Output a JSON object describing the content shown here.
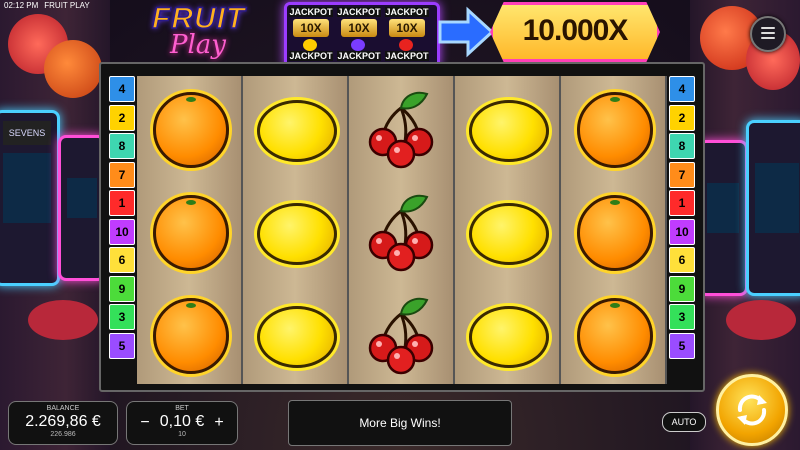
{
  "status_bar": {
    "time": "02:12 PM",
    "app": "FRUIT PLAY"
  },
  "logo": {
    "line1": "FRUIT",
    "line2": "Play"
  },
  "jackpots": [
    {
      "top": "JACKPOT",
      "mult": "10X",
      "bottom": "JACKPOT",
      "symbol_color": "#ffcc00"
    },
    {
      "top": "JACKPOT",
      "mult": "10X",
      "bottom": "JACKPOT",
      "symbol_color": "#7a3cff"
    },
    {
      "top": "JACKPOT",
      "mult": "10X",
      "bottom": "JACKPOT",
      "symbol_color": "#e8231f"
    }
  ],
  "max_win": "10.000X",
  "paylines_left": [
    {
      "n": "4",
      "color": "#2e8fe8"
    },
    {
      "n": "2",
      "color": "#ffd200"
    },
    {
      "n": "8",
      "color": "#3ed6b0"
    },
    {
      "n": "7",
      "color": "#ff8c1a"
    },
    {
      "n": "1",
      "color": "#ff2a2a"
    },
    {
      "n": "10",
      "color": "#c03cff"
    },
    {
      "n": "6",
      "color": "#ffe03a"
    },
    {
      "n": "9",
      "color": "#4cdc3a"
    },
    {
      "n": "3",
      "color": "#34e05a"
    },
    {
      "n": "5",
      "color": "#9a4cff"
    }
  ],
  "paylines_right": [
    {
      "n": "4",
      "color": "#2e8fe8"
    },
    {
      "n": "2",
      "color": "#ffd200"
    },
    {
      "n": "8",
      "color": "#3ed6b0"
    },
    {
      "n": "7",
      "color": "#ff8c1a"
    },
    {
      "n": "1",
      "color": "#ff2a2a"
    },
    {
      "n": "10",
      "color": "#c03cff"
    },
    {
      "n": "6",
      "color": "#ffe03a"
    },
    {
      "n": "9",
      "color": "#4cdc3a"
    },
    {
      "n": "3",
      "color": "#34e05a"
    },
    {
      "n": "5",
      "color": "#9a4cff"
    }
  ],
  "reels": [
    [
      "orange",
      "orange",
      "orange"
    ],
    [
      "lemon",
      "lemon",
      "lemon"
    ],
    [
      "cherry",
      "cherry",
      "cherry"
    ],
    [
      "lemon",
      "lemon",
      "lemon"
    ],
    [
      "orange",
      "orange",
      "orange"
    ]
  ],
  "balance": {
    "label": "BALANCE",
    "value": "2.269,86 €",
    "sub": "226.986"
  },
  "bet": {
    "label": "BET",
    "value": "0,10 €",
    "sub": "10",
    "minus": "−",
    "plus": "+"
  },
  "message": "More Big Wins!",
  "auto_label": "AUTO"
}
